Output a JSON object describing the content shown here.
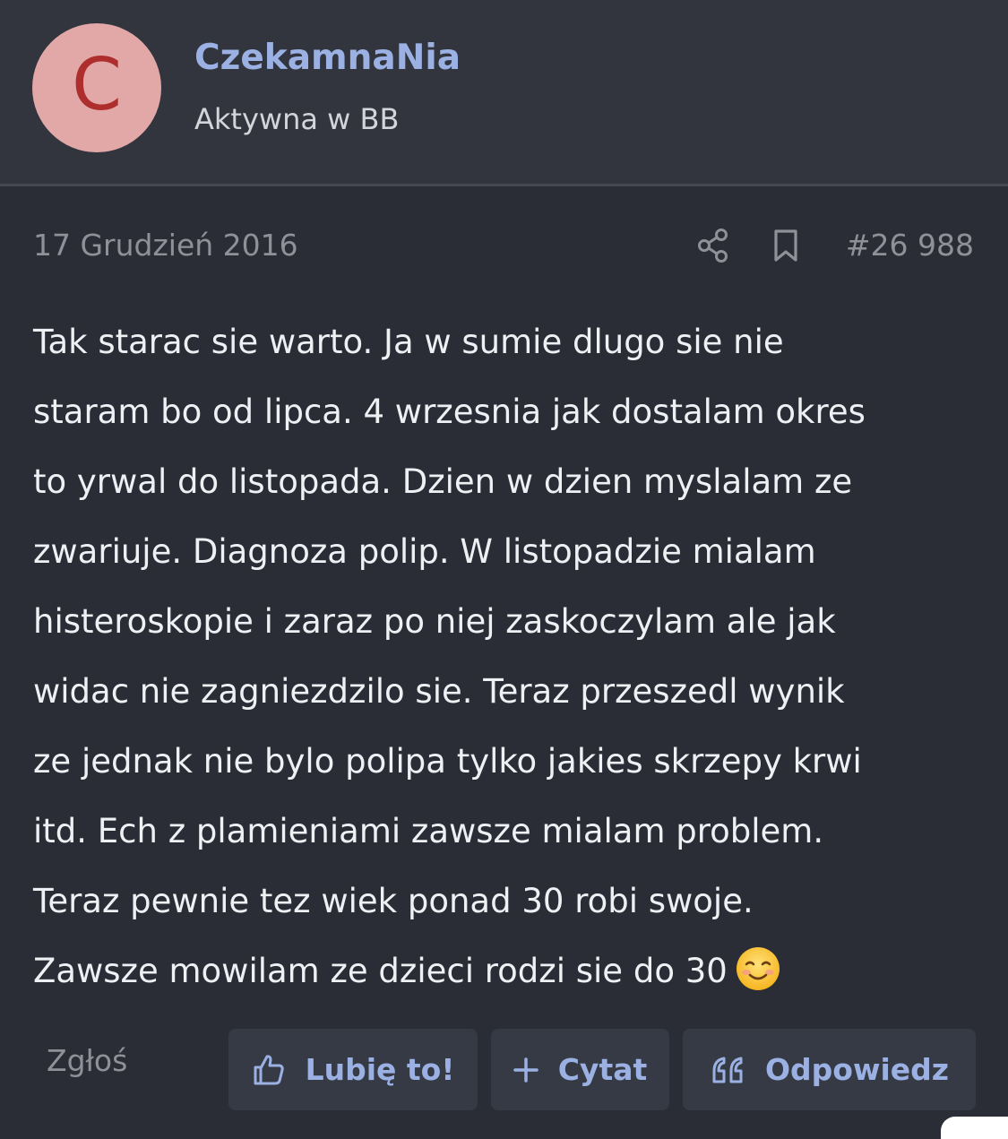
{
  "author": {
    "avatar_letter": "C",
    "name": "CzekamnaNia",
    "rank": "Aktywna w BB"
  },
  "post_meta": {
    "date": "17 Grudzień 2016",
    "number": "#26 988",
    "share_icon": "share-icon",
    "bookmark_icon": "bookmark-icon"
  },
  "post_body": {
    "lines": [
      "Tak starac sie warto. Ja w sumie dlugo sie nie",
      "staram bo od lipca. 4 wrzesnia jak dostalam okres",
      "to yrwal do listopada. Dzien w dzien myslalam ze",
      "zwariuje. Diagnoza polip. W listopadzie mialam",
      "histeroskopie i zaraz po niej zaskoczylam ale jak",
      "widac nie zagniezdzilo sie. Teraz przeszedl wynik",
      "ze jednak nie bylo polipa tylko jakies skrzepy krwi",
      "itd. Ech z plamieniami zawsze mialam problem.",
      "Teraz pewnie tez wiek ponad 30 robi swoje.",
      "Zawsze mowilam ze dzieci rodzi sie do 30"
    ],
    "emoji": "smiling-face-emoji"
  },
  "actions": {
    "report": "Zgłoś",
    "like": "Lubię to!",
    "quote": "Cytat",
    "reply": "Odpowiedz"
  },
  "colors": {
    "background": "#2a2d36",
    "header_background": "#32353d",
    "accent": "#9bb1e3",
    "avatar_bg": "#e2a8a8",
    "avatar_letter": "#ad2e2c",
    "muted_text": "#8e9198",
    "body_text": "#eef0f3",
    "button_bg": "#363a44"
  }
}
